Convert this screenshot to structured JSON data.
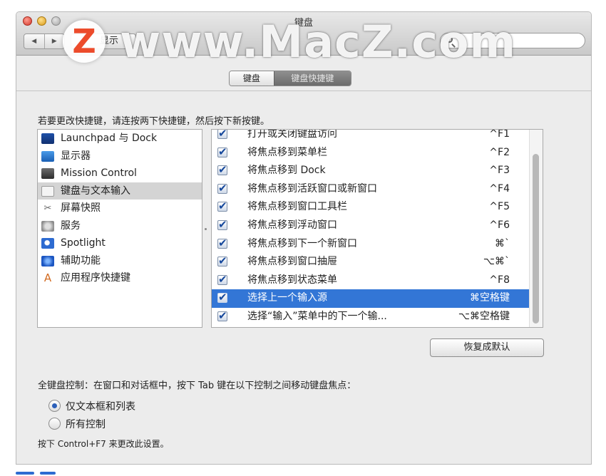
{
  "window": {
    "title": "键盘"
  },
  "toolbar": {
    "show_all_label": "显示",
    "back_symbol": "◀",
    "forward_symbol": "▶",
    "search_placeholder": ""
  },
  "watermark": {
    "text": "www.MacZ.com",
    "logo_letter": "Z",
    "logo_color": "#ec4b2b"
  },
  "tabs": [
    {
      "label": "键盘",
      "selected": false
    },
    {
      "label": "键盘快捷键",
      "selected": true
    }
  ],
  "instruction": "若要更改快捷键，请连按两下快捷键，然后按下新按键。",
  "categories": [
    {
      "label": "Launchpad 与 Dock",
      "icon": "launchpad-dock-icon"
    },
    {
      "label": "显示器",
      "icon": "display-icon"
    },
    {
      "label": "Mission Control",
      "icon": "mission-control-icon"
    },
    {
      "label": "键盘与文本输入",
      "icon": "keyboard-icon",
      "selected": true
    },
    {
      "label": "屏幕快照",
      "icon": "screenshot-icon"
    },
    {
      "label": "服务",
      "icon": "services-gear-icon"
    },
    {
      "label": "Spotlight",
      "icon": "spotlight-icon"
    },
    {
      "label": "辅助功能",
      "icon": "accessibility-icon"
    },
    {
      "label": "应用程序快捷键",
      "icon": "app-shortcuts-icon"
    }
  ],
  "shortcuts": [
    {
      "label": "打开或关闭键盘访问",
      "key": "^F1",
      "checked": true
    },
    {
      "label": "将焦点移到菜单栏",
      "key": "^F2",
      "checked": true
    },
    {
      "label": "将焦点移到 Dock",
      "key": "^F3",
      "checked": true
    },
    {
      "label": "将焦点移到活跃窗口或新窗口",
      "key": "^F4",
      "checked": true
    },
    {
      "label": "将焦点移到窗口工具栏",
      "key": "^F5",
      "checked": true
    },
    {
      "label": "将焦点移到浮动窗口",
      "key": "^F6",
      "checked": true
    },
    {
      "label": "将焦点移到下一个新窗口",
      "key": "⌘`",
      "checked": true
    },
    {
      "label": "将焦点移到窗口抽屉",
      "key": "⌥⌘`",
      "checked": true
    },
    {
      "label": "将焦点移到状态菜单",
      "key": "^F8",
      "checked": true
    },
    {
      "label": "选择上一个输入源",
      "key": "⌘空格键",
      "checked": true,
      "selected": true
    },
    {
      "label": "选择“输入”菜单中的下一个输...",
      "key": "⌥⌘空格键",
      "checked": true
    }
  ],
  "restore_button": "恢复成默认",
  "full_keyboard": {
    "label": "全键盘控制：在窗口和对话框中，按下 Tab 键在以下控制之间移动键盘焦点：",
    "options": [
      {
        "label": "仅文本框和列表",
        "selected": true
      },
      {
        "label": "所有控制",
        "selected": false
      }
    ],
    "hint": "按下 Control+F7 来更改此设置。"
  },
  "colors": {
    "selection": "#3376d6",
    "checkmark": "#16489c"
  }
}
